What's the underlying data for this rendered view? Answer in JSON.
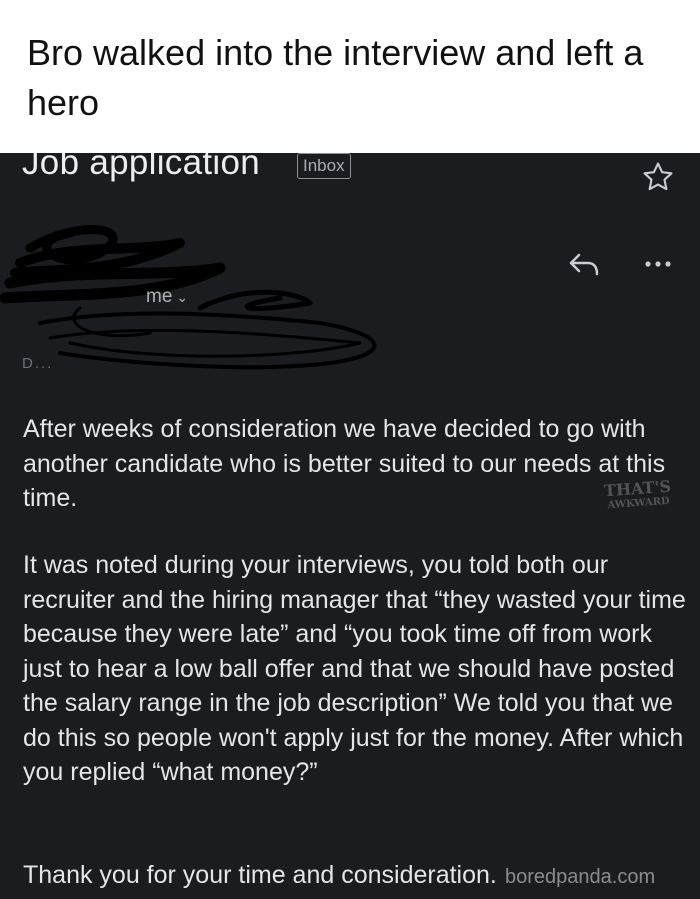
{
  "caption": "Bro walked into the interview and left a hero",
  "email": {
    "subject": "Job application",
    "folder_badge": "Inbox",
    "icons": {
      "star": "star-icon",
      "reply": "reply-icon",
      "more": "more-options-icon",
      "chevron": "chevron-down-icon"
    },
    "recipient_label": "me",
    "recipient_chevron": "⌄",
    "greeting_partial": "D...",
    "paragraphs": [
      "After weeks of consideration we have decided to go with another candidate who is better suited to our needs at this time.",
      "It was noted during your interviews, you told both our recruiter and the hiring manager that “they wasted your time because they were late” and “you took time off from work just to hear a low ball offer and that we should have posted the salary range in the job description” We told you that we do this so people won't apply just for the money. After which you replied “what money?”",
      "Thank you for your time and consideration."
    ]
  },
  "watermarks": {
    "small_line1": "THAT'S",
    "small_line2": "AWKWARD",
    "site": "boredpanda.com"
  },
  "colors": {
    "email_background": "#1a1c20",
    "email_text": "#e3e5e8",
    "caption_background": "#ffffff",
    "caption_text": "#111111"
  }
}
